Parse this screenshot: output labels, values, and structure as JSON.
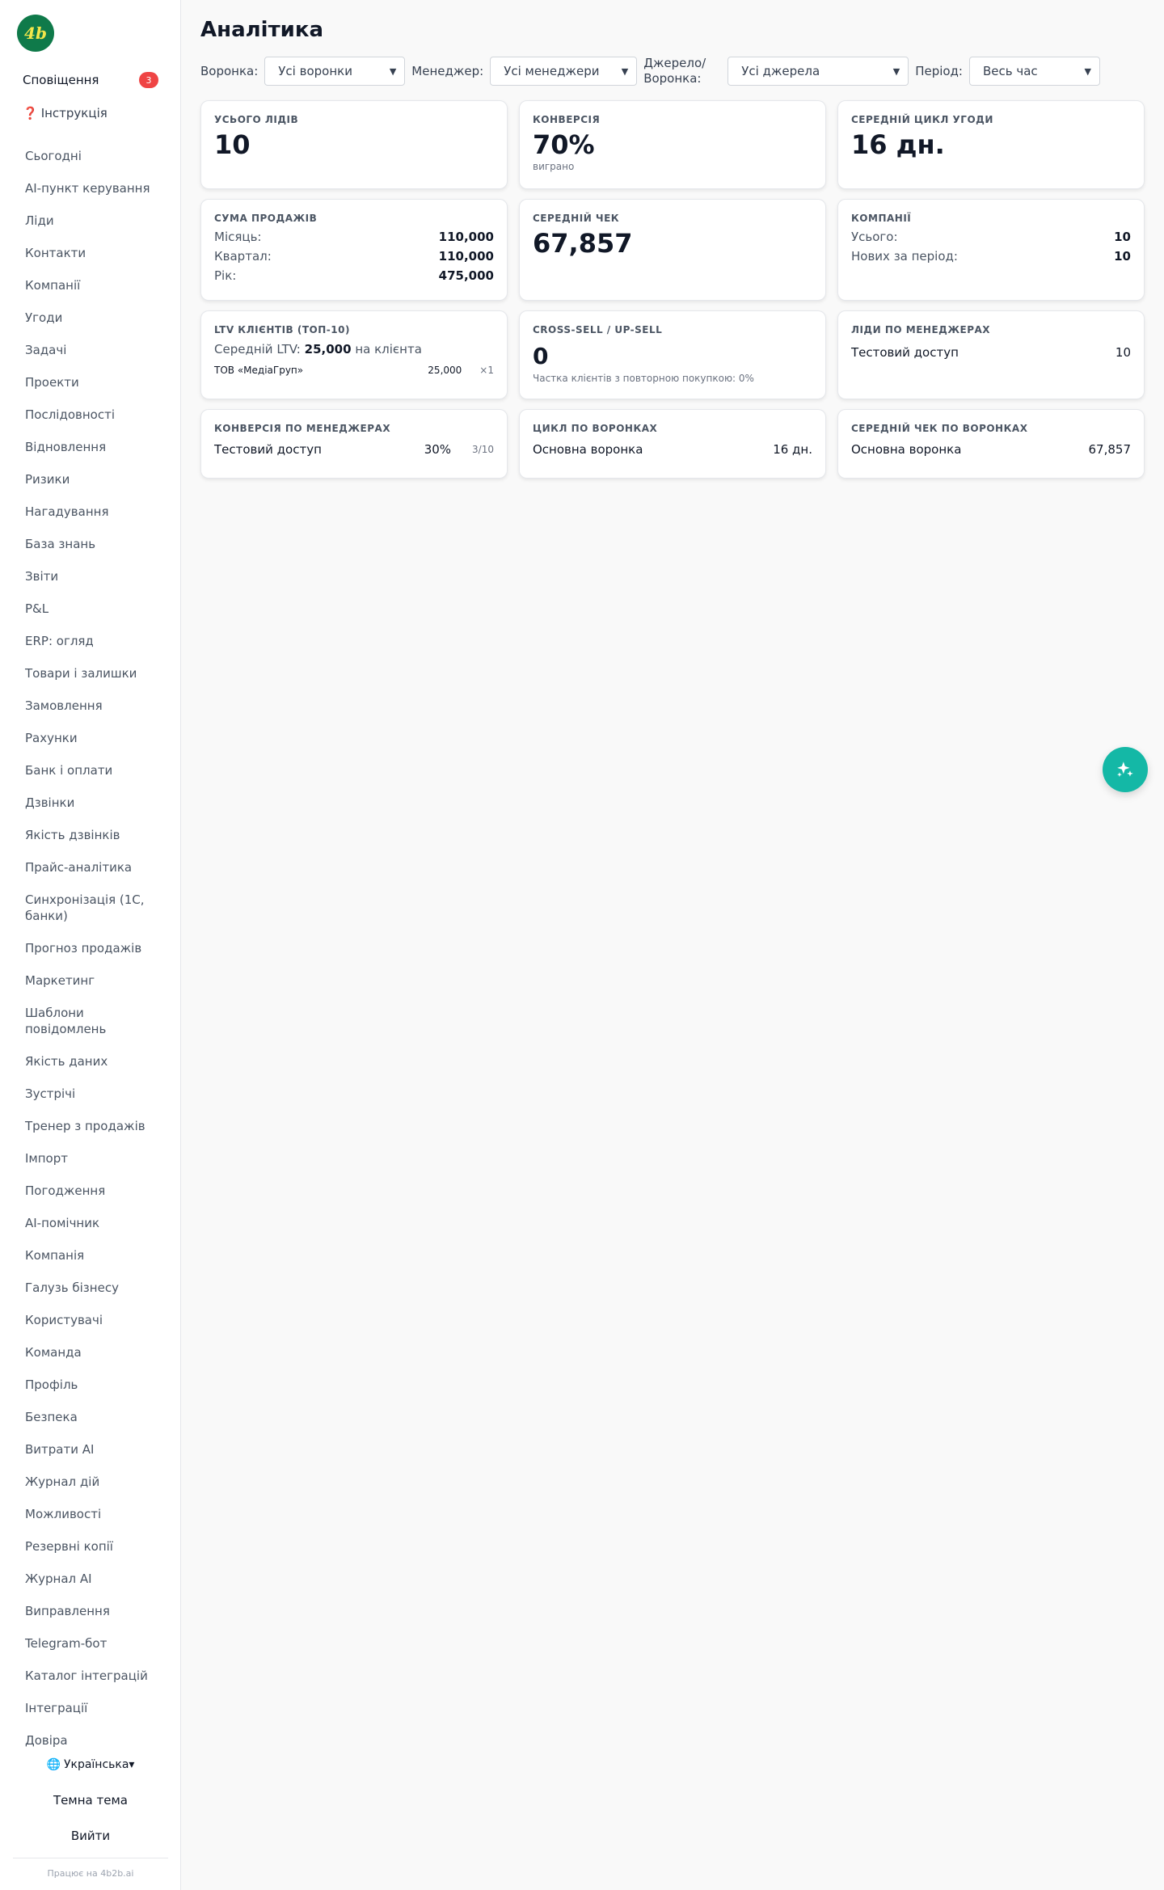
{
  "brand": {
    "logo_text": "4b",
    "logo_bg": "#0f7a4a",
    "logo_fg": "#f3e74a",
    "accent": "#14b8a6"
  },
  "sidebar": {
    "notifications": {
      "label": "Сповіщення",
      "count": "3"
    },
    "guide": {
      "icon": "❓",
      "label": "Інструкція"
    },
    "items": [
      "Сьогодні",
      "AI-пункт керування",
      "Ліди",
      "Контакти",
      "Компанії",
      "Угоди",
      "Задачі",
      "Проекти",
      "Послідовності",
      "Відновлення",
      "Ризики",
      "Нагадування",
      "База знань",
      "Звіти",
      "P&L",
      "ERP: огляд",
      "Товари і залишки",
      "Замовлення",
      "Рахунки",
      "Банк і оплати",
      "Дзвінки",
      "Якість дзвінків",
      "Прайс-аналітика",
      "Синхронізація (1С, банки)",
      "Прогноз продажів",
      "Маркетинг",
      "Шаблони повідомлень",
      "Якість даних",
      "Зустрічі",
      "Тренер з продажів",
      "Імпорт",
      "Погодження",
      "AI-помічник",
      "Компанія",
      "Галузь бізнесу",
      "Користувачі",
      "Команда",
      "Профіль",
      "Безпека",
      "Витрати AI",
      "Журнал дій",
      "Можливості",
      "Резервні копії",
      "Журнал AI",
      "Виправлення",
      "Telegram-бот",
      "Каталог інтеграцій",
      "Інтеграції",
      "Довіра"
    ],
    "language": {
      "icon": "🌐",
      "label": "Українська▾"
    },
    "theme_label": "Темна тема",
    "logout_label": "Вийти",
    "powered_by": "Працює на 4b2b.ai"
  },
  "page": {
    "title": "Аналітика"
  },
  "filters": {
    "funnel": {
      "label": "Воронка:",
      "value": "Усі воронки"
    },
    "manager": {
      "label": "Менеджер:",
      "value": "Усі менеджери"
    },
    "source": {
      "label_line1": "Джерело/",
      "label_line2": "Воронка:",
      "value": "Усі джерела"
    },
    "period": {
      "label": "Період:",
      "value": "Весь час"
    }
  },
  "cards": {
    "total_leads": {
      "title": "Усього лідів",
      "value": "10"
    },
    "conversion": {
      "title": "Конверсія",
      "value": "70%",
      "sub": "виграно"
    },
    "avg_cycle": {
      "title": "Середній цикл угоди",
      "value": "16 дн."
    },
    "sales_sum": {
      "title": "Сума продажів",
      "rows": [
        {
          "label": "Місяць:",
          "value": "110,000"
        },
        {
          "label": "Квартал:",
          "value": "110,000"
        },
        {
          "label": "Рік:",
          "value": "475,000"
        }
      ]
    },
    "avg_check": {
      "title": "Середній чек",
      "value": "67,857"
    },
    "companies": {
      "title": "Компанії",
      "rows": [
        {
          "label": "Усього:",
          "value": "10"
        },
        {
          "label": "Нових за період:",
          "value": "10"
        }
      ]
    },
    "ltv": {
      "title": "LTV клієнтів (топ-10)",
      "avg_prefix": "Середній LTV:",
      "avg_value": "25,000",
      "avg_suffix": "на клієнта",
      "rows": [
        {
          "name": "ТОВ «МедіаГруп»",
          "value": "25,000",
          "mult": "×1"
        }
      ]
    },
    "crosssell": {
      "title": "Cross-sell / Up-sell",
      "value": "0",
      "sub": "Частка клієнтів з повторною покупкою: 0%"
    },
    "leads_by_manager": {
      "title": "Ліди по менеджерах",
      "rows": [
        {
          "name": "Тестовий доступ",
          "value": "10"
        }
      ]
    },
    "conv_by_manager": {
      "title": "Конверсія по менеджерах",
      "rows": [
        {
          "name": "Тестовий доступ",
          "pct": "30%",
          "ratio": "3/10"
        }
      ]
    },
    "cycle_by_funnel": {
      "title": "Цикл по воронках",
      "rows": [
        {
          "name": "Основна воронка",
          "value": "16 дн."
        }
      ]
    },
    "check_by_funnel": {
      "title": "Середній чек по воронках",
      "rows": [
        {
          "name": "Основна воронка",
          "value": "67,857"
        }
      ]
    }
  },
  "fab": {
    "icon": "sparkles-icon"
  }
}
